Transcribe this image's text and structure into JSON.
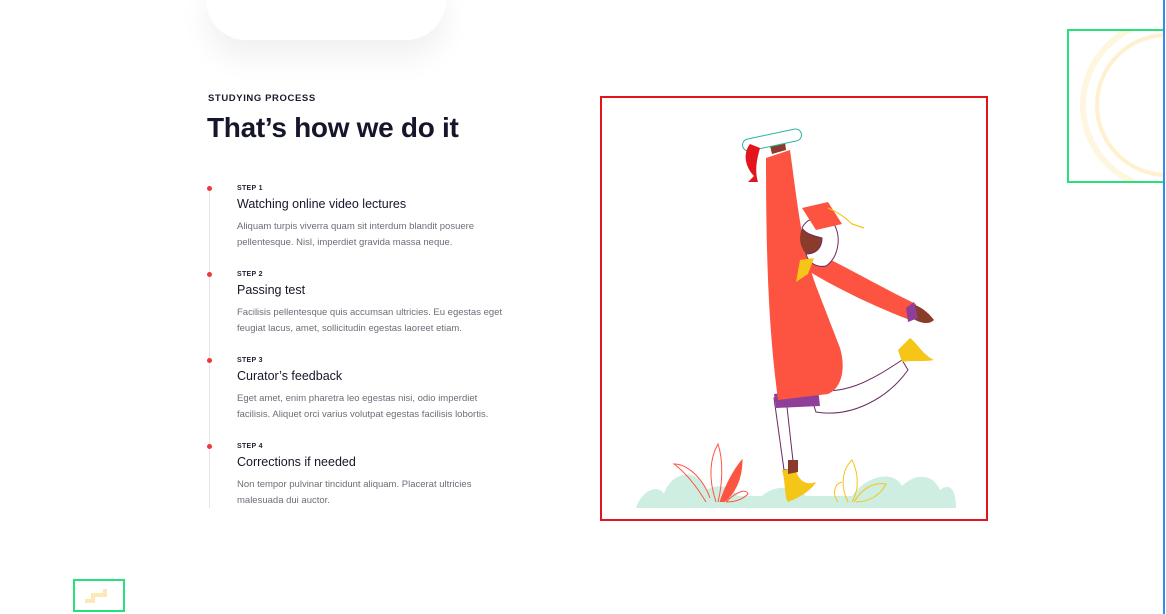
{
  "section": {
    "eyebrow": "STUDYING PROCESS",
    "title": "That’s how we do it"
  },
  "steps": [
    {
      "label": "STEP 1",
      "title": "Watching online video lectures",
      "text": "Aliquam turpis viverra quam sit interdum blandit posuere pellentesque. Nisl, imperdiet gravida massa neque."
    },
    {
      "label": "STEP 2",
      "title": "Passing test",
      "text": "Facilisis pellentesque quis accumsan ultricies. Eu egestas eget feugiat lacus, amet, sollicitudin egestas laoreet etiam."
    },
    {
      "label": "STEP 3",
      "title": "Curator’s feedback",
      "text": "Eget amet, enim pharetra leo egestas nisi, odio imperdiet facilisis. Aliquet orci varius volutpat egestas facilisis lobortis."
    },
    {
      "label": "STEP 4",
      "title": "Corrections if needed",
      "text": "Non tempor pulvinar tincidunt aliquam. Placerat ultricies malesuada dui auctor."
    }
  ],
  "illustration": {
    "icon": "graduate-celebrating-illustration"
  },
  "colors": {
    "accent": "#ea3b34",
    "highlight_frame": "#e2141c",
    "deco_frame": "#27e07a",
    "edge_line": "#2c8ef4",
    "coat": "#fd5441",
    "yellow": "#f5c518",
    "grass": "#cfeee2"
  }
}
